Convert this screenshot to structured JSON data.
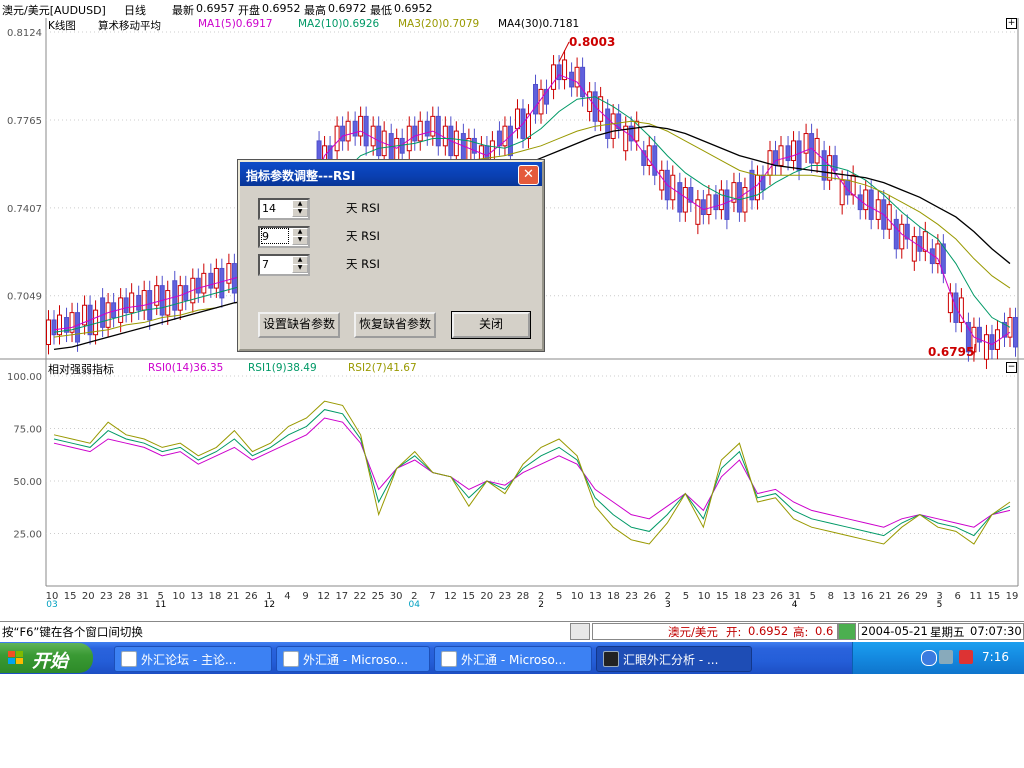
{
  "header": {
    "symbol": "澳元/美元[AUDUSD]",
    "period": "日线",
    "latest_label": "最新",
    "latest": "0.6957",
    "open_label": "开盘",
    "open": "0.6952",
    "high_label": "最高",
    "high": "0.6972",
    "low_label": "最低",
    "low": "0.6952"
  },
  "main_panel": {
    "chart_label": "K线图",
    "indicator_label": "算术移动平均",
    "ma_labels": [
      {
        "text": "MA1(5)0.6917",
        "color": "#cc00cc"
      },
      {
        "text": "MA2(10)0.6926",
        "color": "#009966"
      },
      {
        "text": "MA3(20)0.7079",
        "color": "#999900"
      },
      {
        "text": "MA4(30)0.7181",
        "color": "#000000"
      }
    ],
    "price_ticks": [
      "0.8124",
      "0.7765",
      "0.7407",
      "0.7049"
    ],
    "max_marker": "0.8003",
    "min_marker": "0.6795"
  },
  "rsi_panel": {
    "title": "相对强弱指标",
    "labels": [
      {
        "text": "RSI0(14)36.35",
        "color": "#cc00cc"
      },
      {
        "text": "RSI1(9)38.49",
        "color": "#009966"
      },
      {
        "text": "RSI2(7)41.67",
        "color": "#999900"
      }
    ],
    "ticks": [
      "100.00",
      "75.00",
      "50.00",
      "25.00"
    ]
  },
  "x_axis": {
    "days": [
      "10",
      "15",
      "20",
      "23",
      "28",
      "31",
      "5",
      "10",
      "13",
      "18",
      "21",
      "26",
      "1",
      "4",
      "9",
      "12",
      "17",
      "22",
      "25",
      "30",
      "2",
      "7",
      "12",
      "15",
      "20",
      "23",
      "28",
      "2",
      "5",
      "10",
      "13",
      "18",
      "23",
      "26",
      "2",
      "5",
      "10",
      "15",
      "18",
      "23",
      "26",
      "31",
      "5",
      "8",
      "13",
      "16",
      "21",
      "26",
      "29",
      "3",
      "6",
      "11",
      "15",
      "19"
    ],
    "months": [
      {
        "text": "03",
        "color": "#00a0c0"
      },
      {
        "text": "11",
        "color": "#000000"
      },
      {
        "text": "12",
        "color": "#000000"
      },
      {
        "text": "04",
        "color": "#00a0c0"
      },
      {
        "text": "2",
        "color": "#000000"
      },
      {
        "text": "3",
        "color": "#000000"
      },
      {
        "text": "4",
        "color": "#000000"
      },
      {
        "text": "5",
        "color": "#000000"
      }
    ]
  },
  "chart_data": {
    "type": "line",
    "charts": [
      {
        "name": "candlestick",
        "ylim": [
          0.6795,
          0.8124
        ],
        "series": [
          {
            "name": "MA1(5)",
            "values": [
              0.691,
              0.692,
              0.695,
              0.698,
              0.7,
              0.701,
              0.703,
              0.705,
              0.708,
              0.71,
              0.712,
              0.714,
              0.716,
              0.715,
              0.74,
              0.762,
              0.77,
              0.772,
              0.768,
              0.765,
              0.77,
              0.772,
              0.768,
              0.765,
              0.762,
              0.768,
              0.775,
              0.785,
              0.795,
              0.792,
              0.782,
              0.775,
              0.77,
              0.76,
              0.75,
              0.745,
              0.74,
              0.742,
              0.745,
              0.75,
              0.76,
              0.762,
              0.765,
              0.758,
              0.748,
              0.742,
              0.738,
              0.73,
              0.725,
              0.72,
              0.7,
              0.688,
              0.685,
              0.69
            ]
          },
          {
            "name": "MA2(10)",
            "values": [
              0.69,
              0.691,
              0.693,
              0.695,
              0.697,
              0.699,
              0.7,
              0.702,
              0.704,
              0.706,
              0.708,
              0.71,
              0.712,
              0.714,
              0.728,
              0.745,
              0.755,
              0.762,
              0.765,
              0.766,
              0.767,
              0.769,
              0.769,
              0.768,
              0.766,
              0.765,
              0.768,
              0.773,
              0.78,
              0.785,
              0.786,
              0.782,
              0.777,
              0.77,
              0.762,
              0.755,
              0.75,
              0.746,
              0.744,
              0.746,
              0.751,
              0.755,
              0.758,
              0.758,
              0.756,
              0.752,
              0.746,
              0.739,
              0.733,
              0.728,
              0.718,
              0.705,
              0.696,
              0.692
            ]
          },
          {
            "name": "MA3(20)",
            "values": [
              0.688,
              0.689,
              0.69,
              0.691,
              0.693,
              0.694,
              0.696,
              0.697,
              0.699,
              0.7,
              0.702,
              0.703,
              0.705,
              0.707,
              0.712,
              0.72,
              0.728,
              0.735,
              0.741,
              0.746,
              0.752,
              0.756,
              0.758,
              0.76,
              0.761,
              0.762,
              0.764,
              0.766,
              0.769,
              0.772,
              0.774,
              0.775,
              0.776,
              0.775,
              0.772,
              0.768,
              0.764,
              0.76,
              0.756,
              0.754,
              0.754,
              0.754,
              0.754,
              0.753,
              0.752,
              0.75,
              0.747,
              0.743,
              0.739,
              0.734,
              0.728,
              0.72,
              0.713,
              0.708
            ]
          },
          {
            "name": "MA4(30)",
            "values": [
              0.683,
              0.684,
              0.686,
              0.688,
              0.69,
              0.692,
              0.694,
              0.696,
              0.698,
              0.7,
              0.702,
              0.703,
              0.705,
              0.706,
              0.709,
              0.713,
              0.718,
              0.723,
              0.728,
              0.733,
              0.738,
              0.742,
              0.746,
              0.75,
              0.753,
              0.756,
              0.758,
              0.761,
              0.764,
              0.767,
              0.77,
              0.772,
              0.773,
              0.774,
              0.773,
              0.771,
              0.768,
              0.765,
              0.762,
              0.76,
              0.758,
              0.757,
              0.756,
              0.755,
              0.754,
              0.753,
              0.751,
              0.748,
              0.745,
              0.741,
              0.737,
              0.731,
              0.724,
              0.718
            ]
          }
        ]
      },
      {
        "name": "RSI",
        "ylim": [
          0,
          100
        ],
        "series": [
          {
            "name": "RSI0(14)",
            "values": [
              68,
              66,
              64,
              70,
              68,
              66,
              62,
              64,
              58,
              62,
              66,
              60,
              64,
              68,
              72,
              80,
              78,
              68,
              46,
              56,
              60,
              54,
              52,
              46,
              50,
              48,
              54,
              58,
              62,
              58,
              46,
              40,
              34,
              32,
              38,
              44,
              36,
              52,
              60,
              44,
              46,
              40,
              36,
              34,
              32,
              30,
              28,
              32,
              34,
              32,
              30,
              28,
              34,
              36
            ]
          },
          {
            "name": "RSI1(9)",
            "values": [
              70,
              68,
              66,
              74,
              70,
              68,
              64,
              66,
              60,
              64,
              70,
              62,
              66,
              72,
              76,
              84,
              82,
              70,
              40,
              56,
              62,
              54,
              52,
              42,
              50,
              46,
              56,
              62,
              66,
              60,
              42,
              34,
              28,
              26,
              34,
              44,
              32,
              56,
              64,
              42,
              44,
              36,
              32,
              30,
              28,
              26,
              24,
              30,
              34,
              30,
              28,
              24,
              34,
              38
            ]
          },
          {
            "name": "RSI2(7)",
            "values": [
              72,
              70,
              68,
              78,
              72,
              70,
              66,
              68,
              62,
              66,
              74,
              64,
              68,
              76,
              80,
              88,
              86,
              72,
              34,
              56,
              64,
              54,
              52,
              38,
              50,
              44,
              58,
              66,
              70,
              62,
              38,
              28,
              22,
              20,
              30,
              44,
              28,
              60,
              68,
              40,
              42,
              32,
              28,
              26,
              24,
              22,
              20,
              28,
              34,
              28,
              26,
              20,
              34,
              40
            ]
          }
        ]
      }
    ],
    "price_ticks": [
      0.8124,
      0.7765,
      0.7407,
      0.7049
    ],
    "rsi_ticks": [
      100,
      75,
      50,
      25
    ],
    "max_price": 0.8003,
    "min_price": 0.6795
  },
  "dialog": {
    "title": "指标参数调整---RSI",
    "close_symbol": "✕",
    "params": [
      {
        "value": "14",
        "unit": "天 RSI"
      },
      {
        "value": "9",
        "unit": "天 RSI"
      },
      {
        "value": "7",
        "unit": "天 RSI"
      }
    ],
    "buttons": {
      "set_default": "设置缺省参数",
      "restore_default": "恢复缺省参数",
      "close": "关闭"
    }
  },
  "status_bar": {
    "hint": "按“F6”键在各个窗口间切换",
    "pair": "澳元/美元",
    "open_label": "开:",
    "open": "0.6952",
    "high_label": "高:",
    "high": "0.6",
    "date": "2004-05-21",
    "weekday": "星期五",
    "time": "07:07:30"
  },
  "taskbar": {
    "start": "开始",
    "items": [
      {
        "label": "外汇论坛 - 主论..."
      },
      {
        "label": "外汇通 - Microso..."
      },
      {
        "label": "外汇通 - Microso..."
      },
      {
        "label": "汇眼外汇分析 - ..."
      }
    ],
    "clock": "7:16"
  }
}
